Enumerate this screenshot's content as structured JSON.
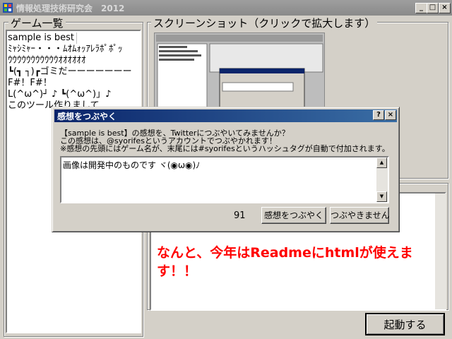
{
  "window": {
    "title": "情報処理技術研究会　2012",
    "controls": {
      "minimize": "_",
      "maximize": "□",
      "close": "×"
    }
  },
  "game_list": {
    "legend": "ゲーム一覧",
    "items": [
      "sample is best",
      "ﾐｬｼﾐｬｰ・・・ﾑｵﾑｫｯｱﾚﾗﾎﾟﾎﾟｯ",
      "ｳｳｳｳｳｳｳｳｳｳｳｵｵｵｵｵｵ",
      "┗(┓ ┐)┏ゴミだーーーーーーー",
      "F#！F#！",
      "L(^ω^)┘ ♪ ┗(^ω^)」♪",
      "このツール作りまして"
    ],
    "selected_index": 0
  },
  "screenshot": {
    "legend": "スクリーンショット（クリックで拡大します）"
  },
  "readme": {
    "text": "なんと、今年はReadmeにhtmlが使えます！！"
  },
  "launch_button": {
    "label": "起動する"
  },
  "dialog": {
    "title": "感想をつぶやく",
    "help": "?",
    "close": "×",
    "message_line1": "【sample is best】の感想を、Twitterにつぶやいてみませんか？",
    "message_line2": "この感想は、@syorifesというアカウントでつぶやかれます！",
    "message_line3": "※感想の先頭にはゲーム名が、末尾には#syorifesというハッシュタグが自動で付加されます。",
    "input_value": "画像は開発中のものです ヾ(◉ω◉)ﾉ",
    "char_count": "91",
    "tweet_button": "感想をつぶやく",
    "cancel_button": "つぶやきません"
  },
  "colors": {
    "accent": "#0a246a",
    "readme_text": "#ff0000"
  }
}
